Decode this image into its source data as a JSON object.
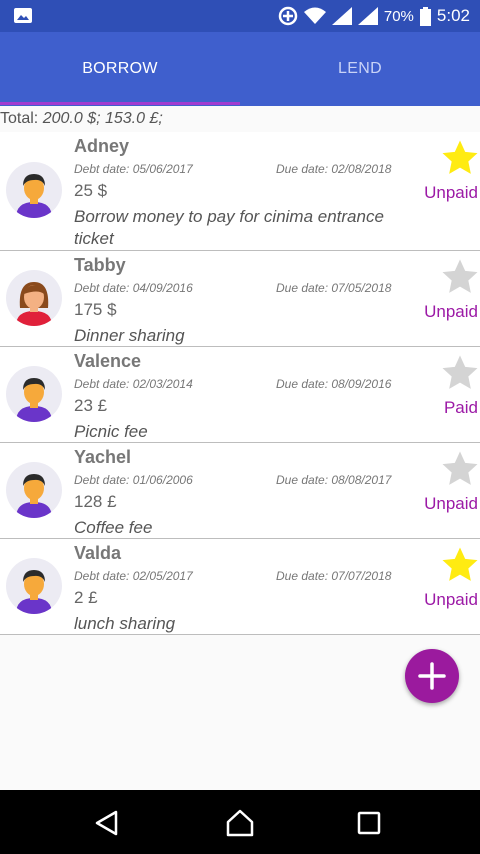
{
  "status_bar": {
    "battery": "70%",
    "time": "5:02"
  },
  "tabs": [
    {
      "label": "BORROW",
      "active": true
    },
    {
      "label": "LEND",
      "active": false
    }
  ],
  "total": {
    "label": "Total:",
    "amount": "200.0 $; 153.0 £;"
  },
  "entries": [
    {
      "name": "Adney",
      "debt_date": "Debt date: 05/06/2017",
      "due_date": "Due date: 02/08/2018",
      "amount": "25 $",
      "note": "Borrow money to pay for cinima entrance ticket",
      "status": "Unpaid",
      "starred": true,
      "avatar": "male"
    },
    {
      "name": "Tabby",
      "debt_date": "Debt date: 04/09/2016",
      "due_date": "Due date: 07/05/2018",
      "amount": "175 $",
      "note": "Dinner sharing",
      "status": "Unpaid",
      "starred": false,
      "avatar": "female"
    },
    {
      "name": "Valence",
      "debt_date": "Debt date: 02/03/2014",
      "due_date": "Due date: 08/09/2016",
      "amount": "23 £",
      "note": "Picnic fee",
      "status": "Paid",
      "starred": false,
      "avatar": "male"
    },
    {
      "name": "Yachel",
      "debt_date": "Debt date: 01/06/2006",
      "due_date": "Due date: 08/08/2017",
      "amount": "128 £",
      "note": "Coffee fee",
      "status": "Unpaid",
      "starred": false,
      "avatar": "male"
    },
    {
      "name": "Valda",
      "debt_date": "Debt date: 02/05/2017",
      "due_date": "Due date: 07/07/2018",
      "amount": "2 £",
      "note": "lunch sharing",
      "status": "Unpaid",
      "starred": true,
      "avatar": "male"
    }
  ],
  "icons": {
    "fab": "plus-icon",
    "nav": [
      "back-icon",
      "home-icon",
      "recents-icon"
    ]
  },
  "colors": {
    "primary": "#3f5fcd",
    "status_bar": "#2f4fb6",
    "accent": "#9b1a9e",
    "star_active": "#ffeb12",
    "star_inactive": "#d4d4d4"
  }
}
